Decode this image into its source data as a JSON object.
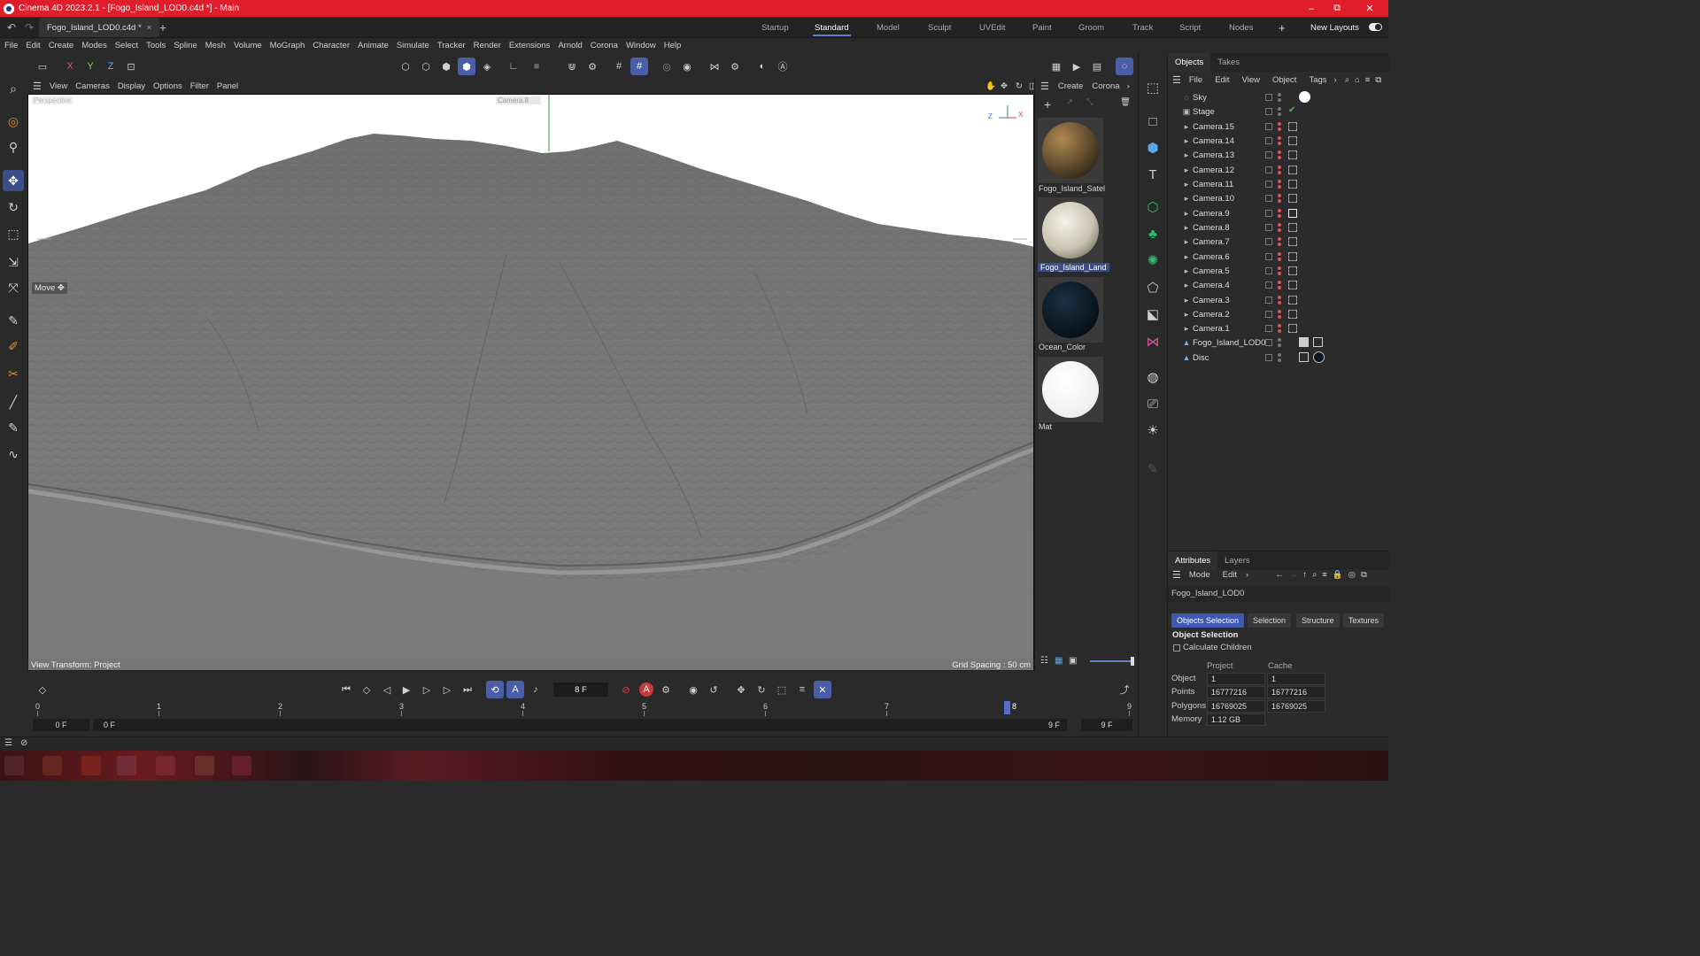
{
  "window": {
    "title": "Cinema 4D 2023.2.1 - [Fogo_Island_LOD0.c4d *] - Main",
    "controls": [
      "–",
      "⧉",
      "✕"
    ]
  },
  "doc_tab": {
    "label": "Fogo_Island_LOD0.c4d *",
    "close": "×",
    "add": "+"
  },
  "layouts": {
    "items": [
      "Startup",
      "Standard",
      "Model",
      "Sculpt",
      "UVEdit",
      "Paint",
      "Groom",
      "Track",
      "Script",
      "Nodes"
    ],
    "active": "Standard",
    "add": "+",
    "new_layouts": "New Layouts"
  },
  "menu": [
    "File",
    "Edit",
    "Create",
    "Modes",
    "Select",
    "Tools",
    "Spline",
    "Mesh",
    "Volume",
    "MoGraph",
    "Character",
    "Animate",
    "Simulate",
    "Tracker",
    "Render",
    "Extensions",
    "Arnold",
    "Corona",
    "Window",
    "Help"
  ],
  "axes": {
    "x": "X",
    "y": "Y",
    "z": "Z"
  },
  "viewport": {
    "menu": [
      "View",
      "Cameras",
      "Display",
      "Options",
      "Filter",
      "Panel"
    ],
    "camera_label": "Perspective",
    "camera_name": "Camera.8",
    "tool_label": "Move",
    "view_transform": "View Transform: Project",
    "grid_spacing": "Grid Spacing : 50 cm",
    "axis_letters": {
      "z": "Z",
      "x": "X"
    }
  },
  "materials": {
    "menu": [
      "Create",
      "Corona"
    ],
    "items": [
      {
        "name": "Fogo_Island_Satel",
        "selected": false
      },
      {
        "name": "Fogo_Island_Land",
        "selected": true
      },
      {
        "name": "Ocean_Color",
        "selected": false
      },
      {
        "name": "Mat",
        "selected": false
      }
    ]
  },
  "objects_panel": {
    "tabs": [
      "Objects",
      "Takes"
    ],
    "menu": [
      "File",
      "Edit",
      "View",
      "Object",
      "Tags"
    ],
    "items": [
      {
        "name": "Sky",
        "icon": "sky-icon"
      },
      {
        "name": "Stage",
        "icon": "stage-icon"
      },
      {
        "name": "Camera.15",
        "icon": "camera-icon"
      },
      {
        "name": "Camera.14",
        "icon": "camera-icon"
      },
      {
        "name": "Camera.13",
        "icon": "camera-icon"
      },
      {
        "name": "Camera.12",
        "icon": "camera-icon"
      },
      {
        "name": "Camera.11",
        "icon": "camera-icon"
      },
      {
        "name": "Camera.10",
        "icon": "camera-icon"
      },
      {
        "name": "Camera.9",
        "icon": "camera-icon"
      },
      {
        "name": "Camera.8",
        "icon": "camera-icon"
      },
      {
        "name": "Camera.7",
        "icon": "camera-icon"
      },
      {
        "name": "Camera.6",
        "icon": "camera-icon"
      },
      {
        "name": "Camera.5",
        "icon": "camera-icon"
      },
      {
        "name": "Camera.4",
        "icon": "camera-icon"
      },
      {
        "name": "Camera.3",
        "icon": "camera-icon"
      },
      {
        "name": "Camera.2",
        "icon": "camera-icon"
      },
      {
        "name": "Camera.1",
        "icon": "camera-icon"
      },
      {
        "name": "Fogo_Island_LOD0",
        "icon": "polygon-object-icon"
      },
      {
        "name": "Disc",
        "icon": "disc-icon"
      }
    ]
  },
  "attributes": {
    "tabs": [
      "Attributes",
      "Layers"
    ],
    "menu": [
      "Mode",
      "Edit"
    ],
    "object_name": "Fogo_Island_LOD0",
    "sub_tabs": [
      "Objects Selection",
      "Selection",
      "Structure",
      "Textures"
    ],
    "active_sub_tab": "Objects Selection",
    "section_title": "Object Selection",
    "calculate_children": "Calculate Children",
    "columns": [
      "Project",
      "Cache"
    ],
    "rows": [
      {
        "label": "Object",
        "project": "1",
        "cache": "1"
      },
      {
        "label": "Points",
        "project": "16777216",
        "cache": "16777216"
      },
      {
        "label": "Polygons",
        "project": "16769025",
        "cache": "16769025"
      },
      {
        "label": "Memory",
        "project": "1.12 GB",
        "cache": ""
      }
    ]
  },
  "timeline": {
    "current_frame": "8 F",
    "ticks": [
      "0",
      "1",
      "2",
      "3",
      "4",
      "5",
      "6",
      "7",
      "8",
      "9"
    ],
    "start_field": "0 F",
    "range_start": "0 F",
    "range_end": "9 F",
    "end_field": "9 F"
  },
  "colors": {
    "titlebar": "#e01e2b",
    "accent": "#4a5fa8",
    "viewport_sky": "#ffffff",
    "terrain": "#7a7a7a"
  }
}
